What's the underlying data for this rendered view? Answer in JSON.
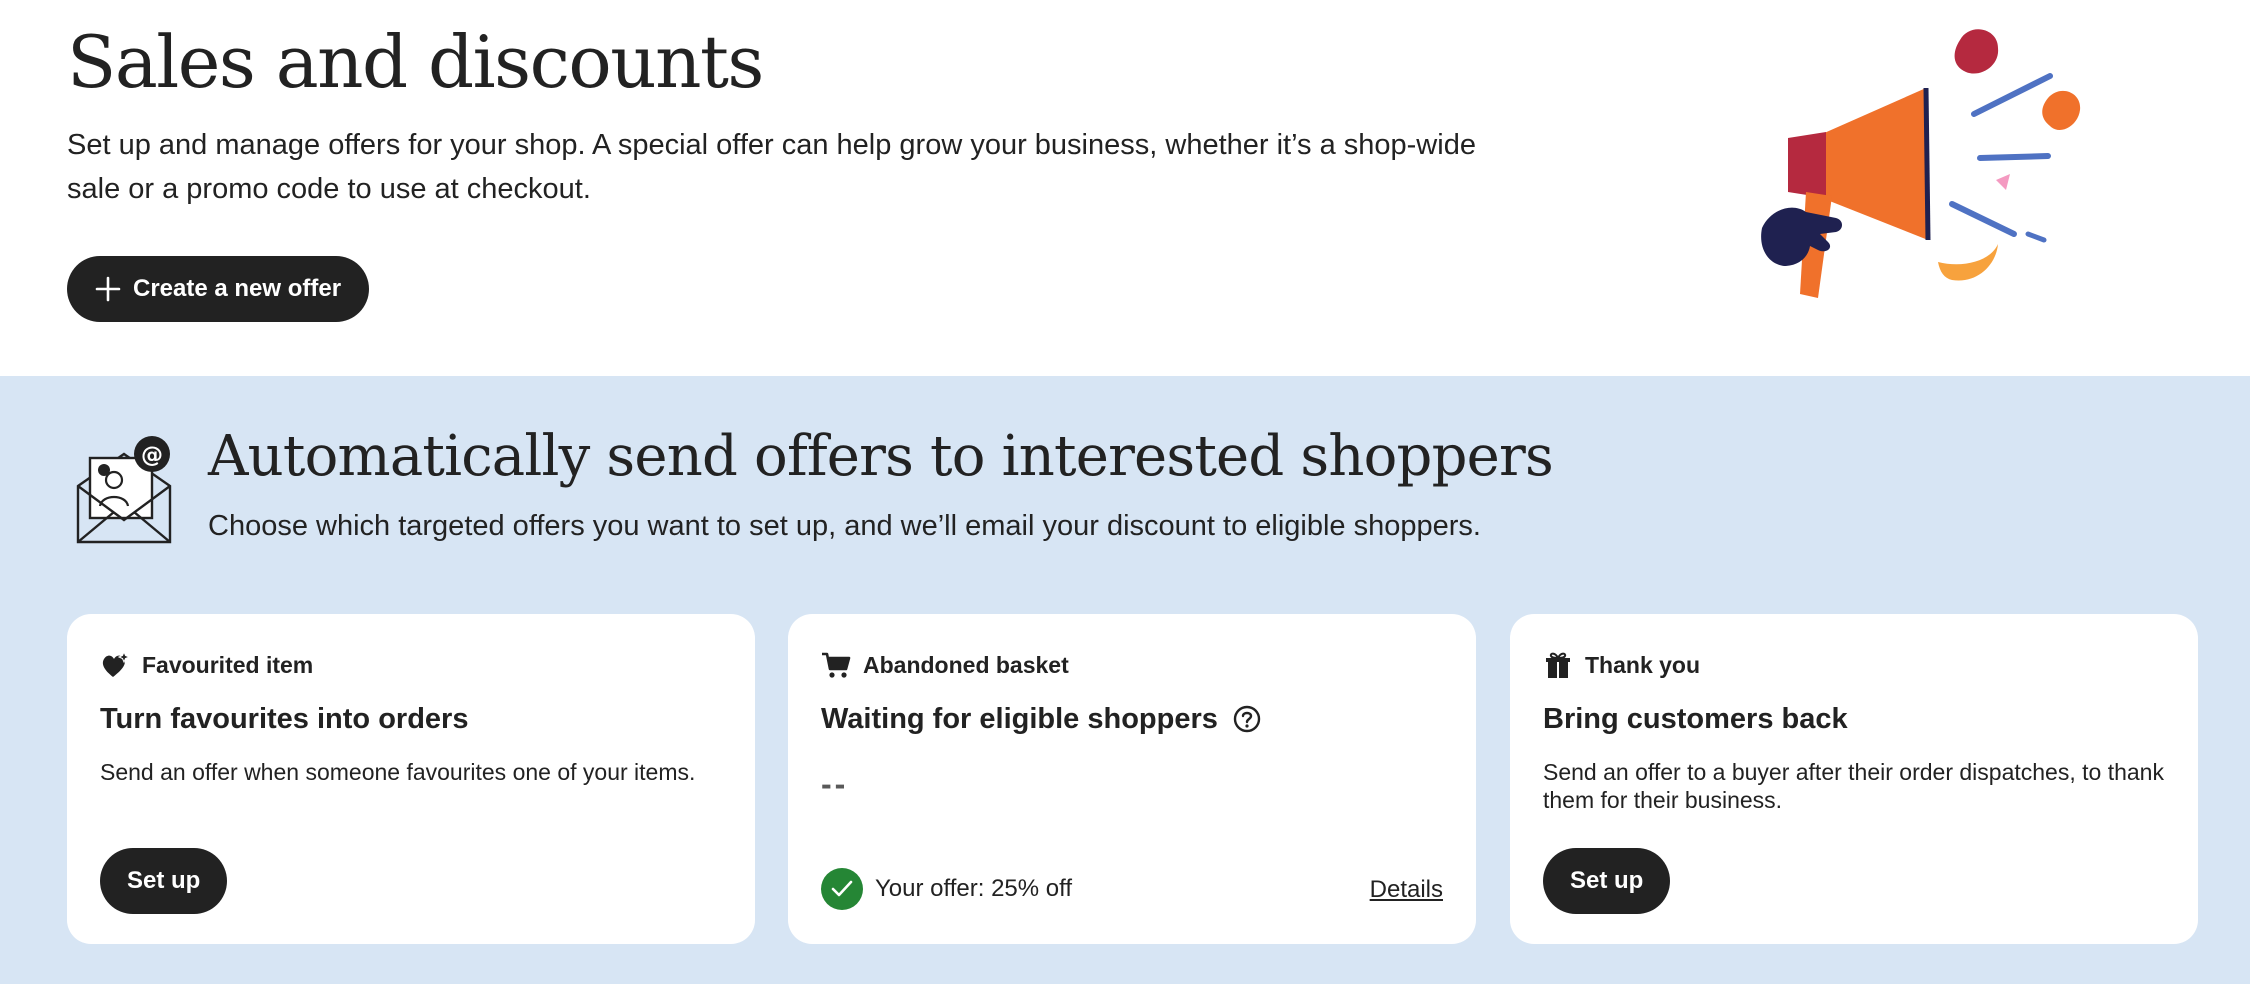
{
  "header": {
    "title": "Sales and discounts",
    "description": "Set up and manage offers for your shop. A special offer can help grow your business, whether it’s a shop-wide sale or a promo code to use at checkout.",
    "create_button_label": "Create a new offer",
    "illustration_icon": "megaphone-illustration"
  },
  "targeted_offers": {
    "title": "Automatically send offers to interested shoppers",
    "description": "Choose which targeted offers you want to set up, and we’ll email your discount to eligible shoppers.",
    "icon": "email-envelope-icon",
    "cards": [
      {
        "kicker": "Favourited item",
        "kicker_icon": "heart-sparkle-icon",
        "title": "Turn favourites into orders",
        "description": "Send an offer when someone favourites one of your items.",
        "button_label": "Set up"
      },
      {
        "kicker": "Abandoned basket",
        "kicker_icon": "cart-icon",
        "title": "Waiting for eligible shoppers",
        "title_icon": "help-circle-icon",
        "value": "--",
        "status_icon": "check-circle-icon",
        "status_text": "Your offer: 25% off",
        "link_label": "Details"
      },
      {
        "kicker": "Thank you",
        "kicker_icon": "gift-icon",
        "title": "Bring customers back",
        "description": "Send an offer to a buyer after their order dispatches, to thank them for their business.",
        "button_label": "Set up"
      }
    ]
  },
  "colors": {
    "band_background": "#d7e5f4",
    "button_background": "#222222",
    "success_green": "#258635"
  }
}
